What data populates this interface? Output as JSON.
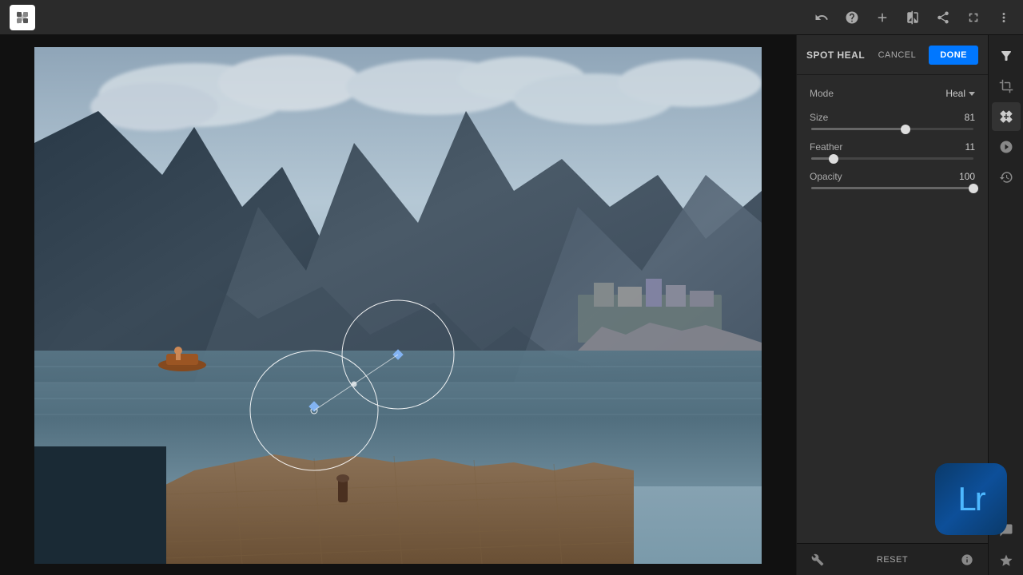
{
  "app": {
    "title": "Adobe Lightroom"
  },
  "topbar": {
    "icons": [
      "undo",
      "help",
      "add",
      "compare",
      "share",
      "expand",
      "more"
    ]
  },
  "spotHeal": {
    "title": "SPOT HEAL",
    "cancelLabel": "CANCEL",
    "doneLabel": "DONE",
    "mode": {
      "label": "Mode",
      "value": "Heal"
    },
    "size": {
      "label": "Size",
      "value": 81,
      "percent": 58
    },
    "feather": {
      "label": "Feather",
      "value": 11,
      "percent": 14
    },
    "opacity": {
      "label": "Opacity",
      "value": 100,
      "percent": 100
    }
  },
  "bottomBar": {
    "resetLabel": "RESET"
  },
  "lrBadge": {
    "text": "Lr"
  }
}
